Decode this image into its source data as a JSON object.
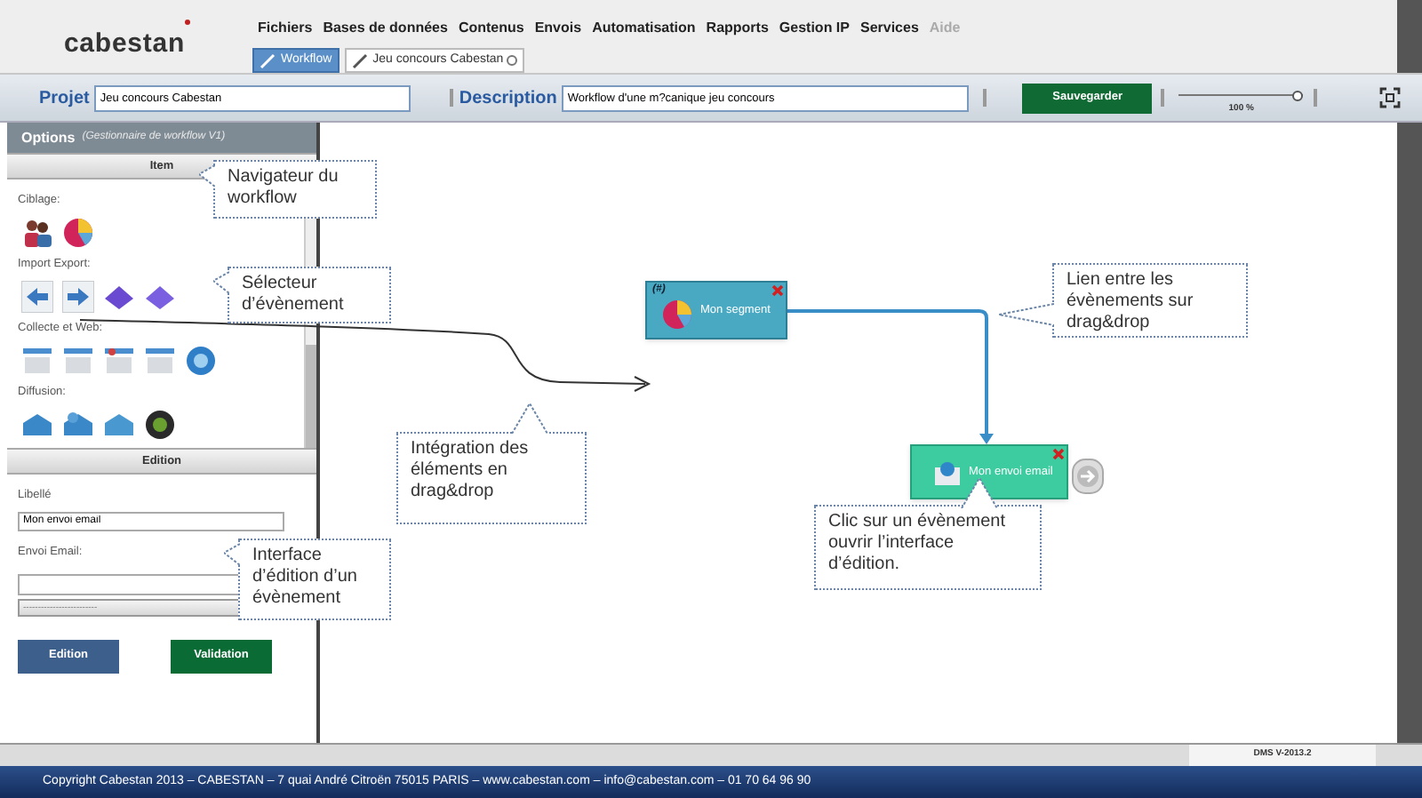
{
  "header": {
    "logo": "cabestan"
  },
  "menu": [
    {
      "label": "Fichiers",
      "disabled": false
    },
    {
      "label": "Bases de données",
      "disabled": false
    },
    {
      "label": "Contenus",
      "disabled": false
    },
    {
      "label": "Envois",
      "disabled": false
    },
    {
      "label": "Automatisation",
      "disabled": false
    },
    {
      "label": "Rapports",
      "disabled": false
    },
    {
      "label": "Gestion IP",
      "disabled": false
    },
    {
      "label": "Services",
      "disabled": false
    },
    {
      "label": "Aide",
      "disabled": true
    }
  ],
  "tabs": [
    {
      "label": "Workflow",
      "selected": true,
      "closable": false
    },
    {
      "label": "Jeu concours Cabestan",
      "selected": false,
      "closable": true
    }
  ],
  "toolbar": {
    "project_label": "Projet",
    "project_value": "Jeu concours Cabestan",
    "description_label": "Description",
    "description_value": "Workflow d'une m?canique jeu concours",
    "save_button": "Sauvegarder",
    "zoom": {
      "level": 0.95,
      "reading": "100 %"
    }
  },
  "panel": {
    "title": "Options",
    "subtitle": "(Gestionnaire de workflow V1)",
    "item_header": "Item",
    "groups": [
      {
        "label": "Ciblage:"
      },
      {
        "label": "Import Export:"
      },
      {
        "label": "Collecte et Web:"
      },
      {
        "label": "Diffusion:"
      }
    ],
    "edition_header": "Edition",
    "libelle_label": "Libellé",
    "libelle_value": "Mon envoi email",
    "email_label": "Envoi Email:",
    "select_value": "-------------------------",
    "buttons": [
      "Edition",
      "Validation"
    ]
  },
  "nodes": [
    {
      "kind": "segment",
      "badge": "(#)",
      "label": "Mon segment"
    },
    {
      "kind": "email",
      "label": "Mon envoi email"
    }
  ],
  "callouts": [
    "Navigateur du workflow",
    "Sélecteur d’évènement",
    "Intégration des éléments en drag&drop",
    "Interface d’édition d’un évènement",
    "Lien entre les évènements sur drag&drop",
    "Clic sur un évènement ouvrir l’interface d’édition."
  ],
  "status": {
    "version": "DMS V-2013.2",
    "copyright": "Copyright Cabestan 2013 – CABESTAN – 7 quai André Citroën 75015 PARIS – www.cabestan.com – info@cabestan.com – 01 70 64 96 90"
  }
}
